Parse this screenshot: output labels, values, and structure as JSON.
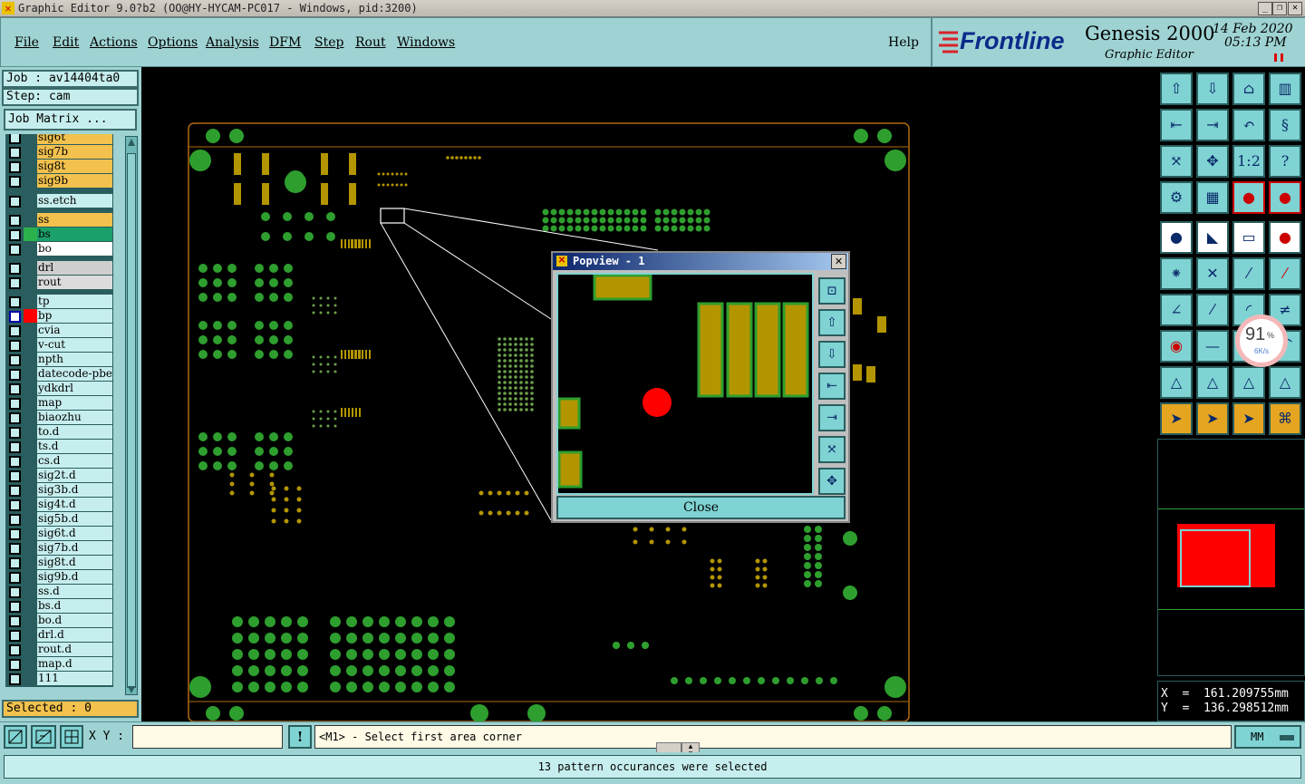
{
  "window": {
    "title": "Graphic Editor 9.0?b2 (OO@HY-HYCAM-PC017 - Windows, pid:3200)"
  },
  "menu": [
    "File",
    "Edit",
    "Actions",
    "Options",
    "Analysis",
    "DFM",
    "Step",
    "Rout",
    "Windows"
  ],
  "help_label": "Help",
  "brand": {
    "logo_text": "Frontline",
    "product": "Genesis 2000",
    "subtitle": "Graphic Editor",
    "date": "14 Feb 2020",
    "time": "05:13 PM"
  },
  "job": {
    "label": "Job : av14404ta0",
    "step": "Step: cam",
    "matrix_button": "Job Matrix ..."
  },
  "layers": [
    {
      "name": "sig6t",
      "color": "#f2c14e"
    },
    {
      "name": "sig7b",
      "color": "#f2c14e"
    },
    {
      "name": "sig8t",
      "color": "#f2c14e"
    },
    {
      "name": "sig9b",
      "color": "#f2c14e"
    },
    {
      "name": "ss.etch",
      "color": "#c7eeee"
    },
    {
      "name": "ss",
      "color": "#f2c14e"
    },
    {
      "name": "bs",
      "color": "#1aa06a",
      "swatch": "#2bb24c"
    },
    {
      "name": "bo",
      "color": "#ffffff"
    },
    {
      "name": "drl",
      "color": "#cfcfcf"
    },
    {
      "name": "rout",
      "color": "#dcdcdc"
    },
    {
      "name": "tp",
      "color": "#c7eeee"
    },
    {
      "name": "bp",
      "color": "#c7eeee",
      "swatch": "#ff0000",
      "checked": true
    },
    {
      "name": "cvia",
      "color": "#c7eeee"
    },
    {
      "name": "v-cut",
      "color": "#c7eeee"
    },
    {
      "name": "npth",
      "color": "#c7eeee"
    },
    {
      "name": "datecode-pbe",
      "color": "#c7eeee"
    },
    {
      "name": "ydkdrl",
      "color": "#c7eeee"
    },
    {
      "name": "map",
      "color": "#c7eeee"
    },
    {
      "name": "biaozhu",
      "color": "#c7eeee"
    },
    {
      "name": "to.d",
      "color": "#c7eeee"
    },
    {
      "name": "ts.d",
      "color": "#c7eeee"
    },
    {
      "name": "cs.d",
      "color": "#c7eeee"
    },
    {
      "name": "sig2t.d",
      "color": "#c7eeee"
    },
    {
      "name": "sig3b.d",
      "color": "#c7eeee"
    },
    {
      "name": "sig4t.d",
      "color": "#c7eeee"
    },
    {
      "name": "sig5b.d",
      "color": "#c7eeee"
    },
    {
      "name": "sig6t.d",
      "color": "#c7eeee"
    },
    {
      "name": "sig7b.d",
      "color": "#c7eeee"
    },
    {
      "name": "sig8t.d",
      "color": "#c7eeee"
    },
    {
      "name": "sig9b.d",
      "color": "#c7eeee"
    },
    {
      "name": "ss.d",
      "color": "#c7eeee"
    },
    {
      "name": "bs.d",
      "color": "#c7eeee"
    },
    {
      "name": "bo.d",
      "color": "#c7eeee"
    },
    {
      "name": "drl.d",
      "color": "#c7eeee"
    },
    {
      "name": "rout.d",
      "color": "#c7eeee"
    },
    {
      "name": "map.d",
      "color": "#c7eeee"
    },
    {
      "name": "111",
      "color": "#c7eeee"
    }
  ],
  "selected": "Selected : 0",
  "popview": {
    "title": "Popview - 1",
    "close_label": "Close"
  },
  "network_widget": {
    "percent": "91",
    "unit": "%",
    "speed": "6K/s"
  },
  "coords": {
    "x": "X  =  161.209755mm",
    "y": "Y  =  136.298512mm"
  },
  "bottom": {
    "xy_label": "X Y :",
    "xy_value": "",
    "prompt": "<M1> - Select first area corner",
    "units": "MM"
  },
  "status": "13 pattern occurances were selected",
  "colors": {
    "panel": "#9fd3d3",
    "pad_green": "#2e9e2e",
    "pad_gold": "#b39500",
    "accent_red": "#ff0000"
  }
}
